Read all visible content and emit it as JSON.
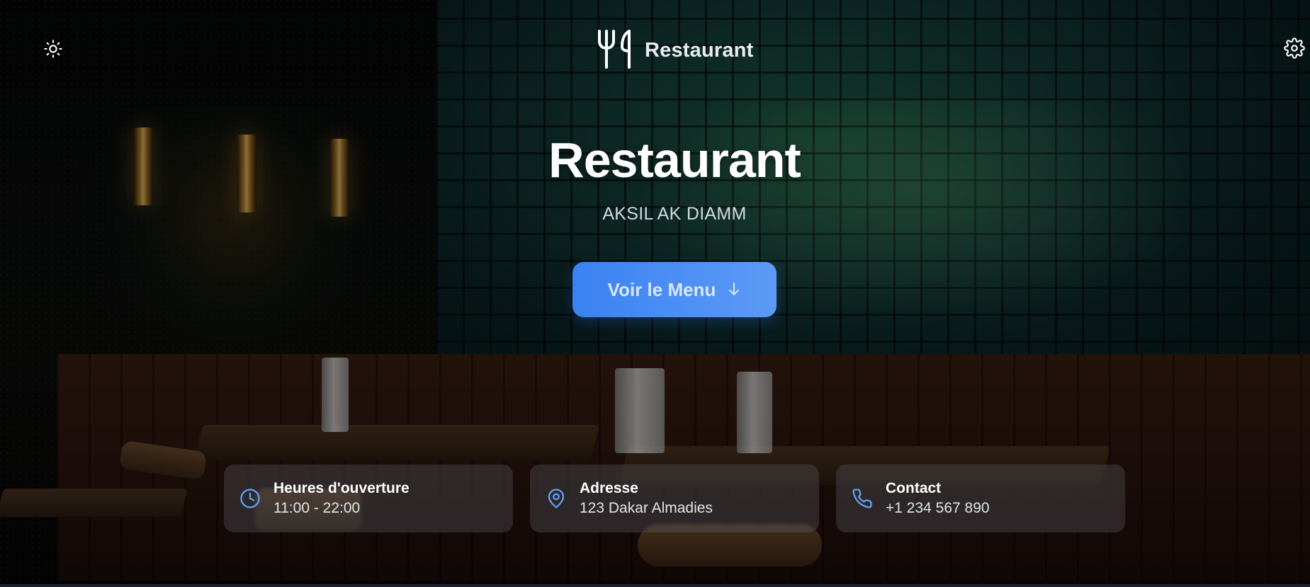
{
  "header": {
    "brand_name": "Restaurant",
    "theme_toggle_icon": "sun-icon",
    "settings_icon": "gear-icon",
    "logo_icon": "fork-knife-icon"
  },
  "hero": {
    "title": "Restaurant",
    "subtitle": "AKSIL AK DIAMM",
    "cta_label": "Voir le Menu",
    "cta_icon": "arrow-down-icon"
  },
  "info_cards": [
    {
      "icon": "clock-icon",
      "title": "Heures d'ouverture",
      "value": "11:00 - 22:00"
    },
    {
      "icon": "map-pin-icon",
      "title": "Adresse",
      "value": "123 Dakar Almadies"
    },
    {
      "icon": "phone-icon",
      "title": "Contact",
      "value": "+1 234 567 890"
    }
  ],
  "colors": {
    "accent": "#3B82F6",
    "icon_accent": "#60A5FA",
    "card_bg": "rgba(95,100,110,0.32)"
  }
}
